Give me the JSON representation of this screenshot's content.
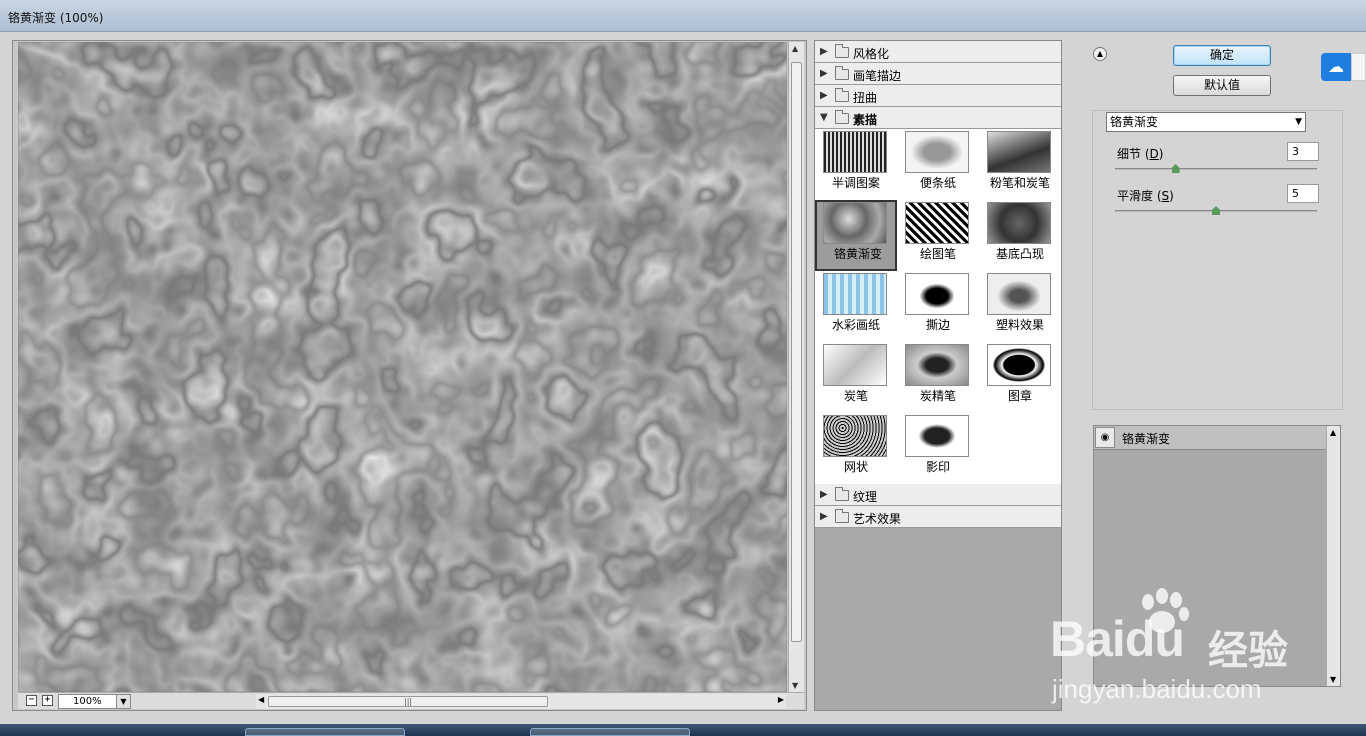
{
  "window": {
    "title": "铬黄渐变 (100%)"
  },
  "preview": {
    "zoom": "100%",
    "zoom_out": "−",
    "zoom_in": "+"
  },
  "gallery": {
    "categories_top": [
      {
        "label": "风格化",
        "expanded": false
      },
      {
        "label": "画笔描边",
        "expanded": false
      },
      {
        "label": "扭曲",
        "expanded": false
      },
      {
        "label": "素描",
        "expanded": true
      }
    ],
    "thumbs": [
      {
        "label": "半调图案"
      },
      {
        "label": "便条纸"
      },
      {
        "label": "粉笔和炭笔"
      },
      {
        "label": "铬黄渐变",
        "selected": true
      },
      {
        "label": "绘图笔"
      },
      {
        "label": "基底凸现"
      },
      {
        "label": "水彩画纸"
      },
      {
        "label": "撕边"
      },
      {
        "label": "塑料效果"
      },
      {
        "label": "炭笔"
      },
      {
        "label": "炭精笔"
      },
      {
        "label": "图章"
      },
      {
        "label": "网状"
      },
      {
        "label": "影印"
      }
    ],
    "categories_bottom": [
      {
        "label": "纹理",
        "expanded": false
      },
      {
        "label": "艺术效果",
        "expanded": false
      }
    ]
  },
  "right": {
    "ok_label": "确定",
    "default_label": "默认值",
    "filter_select": "铬黄渐变",
    "params": [
      {
        "label": "细节",
        "hotkey": "D",
        "value": "3",
        "fraction": 0.3
      },
      {
        "label": "平滑度",
        "hotkey": "S",
        "value": "5",
        "fraction": 0.5
      }
    ],
    "layer_name": "铬黄渐变"
  },
  "watermark": {
    "brand_left": "Bai",
    "brand_right": "du",
    "cn": "经验",
    "url": "jingyan.baidu.com"
  },
  "colors": {
    "accent": "#3c7fb1",
    "side_icon": "#1f7ee0"
  }
}
